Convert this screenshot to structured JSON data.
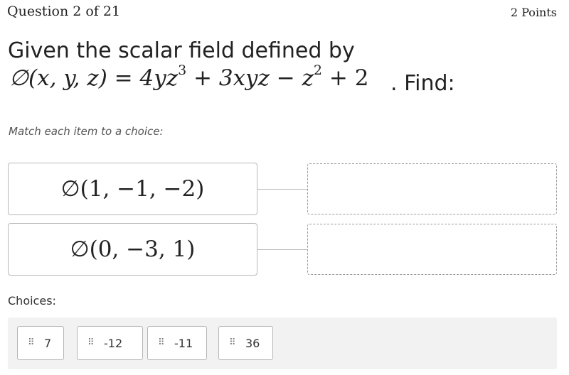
{
  "header": {
    "question_number": "Question 2 of 21",
    "points": "2 Points"
  },
  "question": {
    "line1": "Given the scalar field defined by",
    "formula": {
      "lhs": "∅(x, y, z) = 4yz",
      "exp1": "3",
      "mid": " + 3xyz − z",
      "exp2": "2",
      "tail": " + 2"
    },
    "find": ". Find:"
  },
  "instruction": "Match each item to a choice:",
  "prompts": [
    {
      "text": "∅(1, −1, −2)"
    },
    {
      "text": "∅(0, −3, 1)"
    }
  ],
  "choices_label": "Choices:",
  "choices": [
    {
      "label": "7",
      "icon": "drag-handle-icon"
    },
    {
      "label": "-12",
      "icon": "drag-handle-icon"
    },
    {
      "label": "-11",
      "icon": "drag-handle-icon"
    },
    {
      "label": "36",
      "icon": "drag-handle-icon"
    }
  ]
}
